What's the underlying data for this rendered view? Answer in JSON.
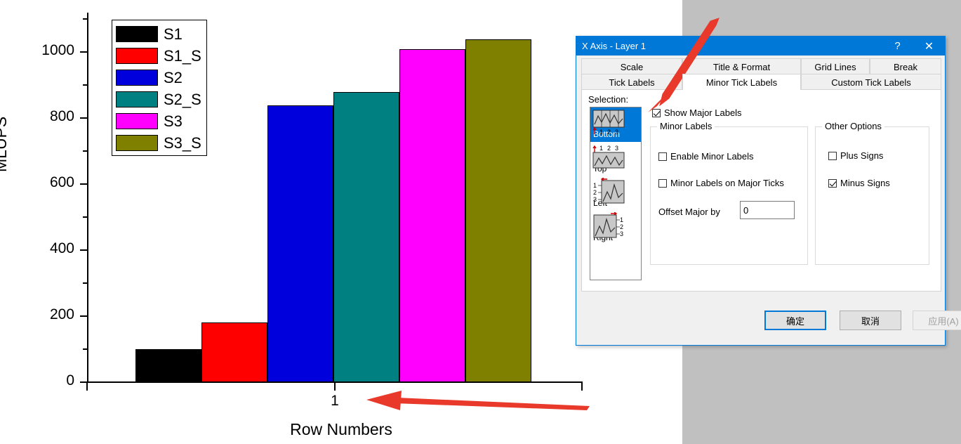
{
  "chart_data": {
    "type": "bar",
    "title": "",
    "xlabel": "Row Numbers",
    "ylabel": "MLUPS",
    "categories": [
      "1"
    ],
    "xtick_labels": [
      "1"
    ],
    "ytick_labels": [
      "0",
      "200",
      "400",
      "600",
      "800",
      "1000"
    ],
    "ytick_values": [
      0,
      200,
      400,
      600,
      800,
      1000
    ],
    "yminor_values": [
      100,
      300,
      500,
      700,
      900,
      1100
    ],
    "ylim": [
      0,
      1120
    ],
    "grid": false,
    "legend_position": "top-left",
    "series": [
      {
        "name": "S1",
        "color": "#000000",
        "values": [
          100
        ]
      },
      {
        "name": "S1_S",
        "color": "#ff0000",
        "values": [
          180
        ]
      },
      {
        "name": "S2",
        "color": "#0000dd",
        "values": [
          840
        ]
      },
      {
        "name": "S2_S",
        "color": "#008080",
        "values": [
          880
        ]
      },
      {
        "name": "S3",
        "color": "#ff00ff",
        "values": [
          1010
        ]
      },
      {
        "name": "S3_S",
        "color": "#808000",
        "values": [
          1040
        ]
      }
    ]
  },
  "dialog": {
    "title": "X Axis - Layer 1",
    "help_glyph": "?",
    "close_glyph": "✕",
    "tabs_row1": [
      {
        "label": "Scale",
        "active": false
      },
      {
        "label": "Title & Format",
        "active": false
      },
      {
        "label": "Grid Lines",
        "active": false
      },
      {
        "label": "Break",
        "active": false
      }
    ],
    "tabs_row2": [
      {
        "label": "Tick Labels",
        "active": false
      },
      {
        "label": "Minor Tick Labels",
        "active": true
      },
      {
        "label": "Custom Tick Labels",
        "active": false
      }
    ],
    "selection": {
      "caption": "Selection:",
      "items": [
        {
          "label": "Bottom",
          "selected": true
        },
        {
          "label": "Top",
          "selected": false
        },
        {
          "label": "Left",
          "selected": false
        },
        {
          "label": "Right",
          "selected": false
        }
      ]
    },
    "show_major_labels": {
      "label": "Show Major Labels",
      "checked": true
    },
    "minor_labels_group": {
      "title": "Minor Labels",
      "enable_minor_labels": {
        "label": "Enable Minor Labels",
        "checked": false
      },
      "minor_labels_on_major_ticks": {
        "label": "Minor Labels on Major Ticks",
        "checked": false
      },
      "offset_major_by": {
        "label": "Offset Major by",
        "value": "0"
      }
    },
    "other_options_group": {
      "title": "Other Options",
      "plus_signs": {
        "label": "Plus Signs",
        "checked": false
      },
      "minus_signs": {
        "label": "Minus Signs",
        "checked": true
      }
    },
    "buttons": {
      "ok": "确定",
      "cancel": "取消",
      "apply": "应用(A)"
    }
  },
  "annotations": {
    "arrow_color": "#e8392a",
    "arrow_top_name": "red-arrow-to-minor-tick-labels-tab",
    "arrow_bottom_name": "red-arrow-to-x-axis-tick-label"
  },
  "colors": {
    "accent": "#0078d7",
    "dialog_bg": "#f0f0f0",
    "desktop": "#c0c0c0",
    "plot_bg": "#ffffff"
  }
}
